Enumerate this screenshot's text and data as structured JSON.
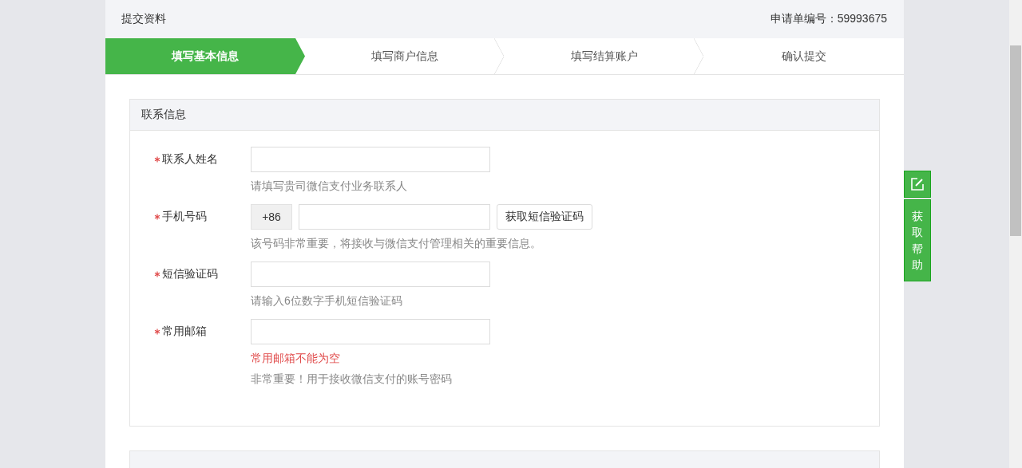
{
  "header": {
    "title": "提交资料",
    "application_no": "申请单编号：59993675"
  },
  "steps": [
    {
      "label": "填写基本信息",
      "selected": true
    },
    {
      "label": "填写商户信息",
      "selected": false
    },
    {
      "label": "填写结算账户",
      "selected": false
    },
    {
      "label": "确认提交",
      "selected": false
    }
  ],
  "section": {
    "title": "联系信息",
    "fields": [
      {
        "label": "联系人姓名",
        "required": true,
        "hint": "请填写贵司微信支付业务联系人"
      },
      {
        "label": "手机号码",
        "required": true,
        "prefix": "+86",
        "button": "获取短信验证码",
        "hint": "该号码非常重要，将接收与微信支付管理相关的重要信息。"
      },
      {
        "label": "短信验证码",
        "required": true,
        "hint": "请输入6位数字手机短信验证码"
      },
      {
        "label": "常用邮箱",
        "required": true,
        "error": "常用邮箱不能为空",
        "hint": "非常重要！用于接收微信支付的账号密码"
      }
    ]
  },
  "help": {
    "label": "获取帮助"
  }
}
